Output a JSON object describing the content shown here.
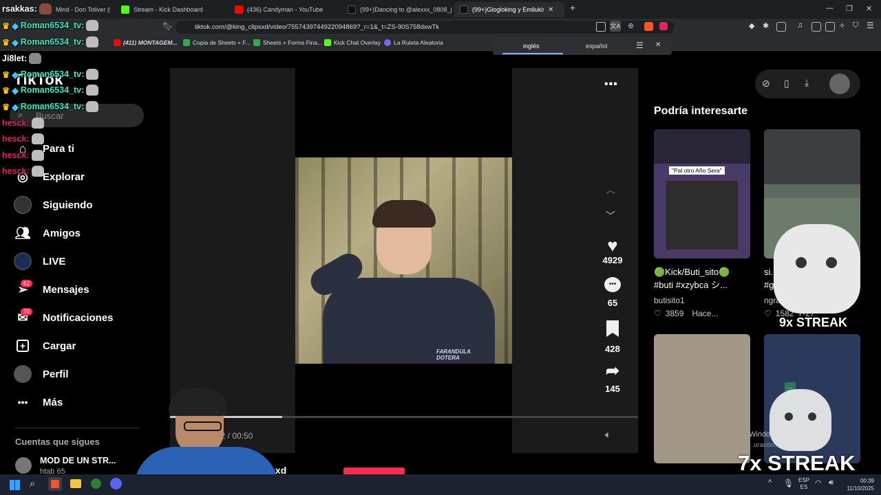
{
  "browser": {
    "tabs": [
      {
        "label": "Mind - Don Toliver (fe",
        "color": "#6b3a3a"
      },
      {
        "label": "Stream - Kick Dashboard",
        "color": "#53fc18"
      },
      {
        "label": "(436) Candyman - YouTube",
        "color": "#ff0000"
      },
      {
        "label": "(99+)Dancing to @alexxx_0808_j's Tr",
        "color": "#111111"
      },
      {
        "label": "(99+)Glogloking y Emilukis: I",
        "color": "#111111"
      }
    ],
    "new_tab": "+",
    "url": "tiktok.com/@king_clipsxd/video/7557439744922094869?_r=1&_t=ZS-90S758dxwTk",
    "bookmarks": [
      {
        "label": "(411) MONTAGEM...",
        "color": "#ff0000"
      },
      {
        "label": "Copia de Sheets + F...",
        "color": "#34a853"
      },
      {
        "label": "Sheets + Forms Fina...",
        "color": "#34a853"
      },
      {
        "label": "Kick Chat Overlay",
        "color": "#53fc18"
      },
      {
        "label": "La Ruleta Aleatoria",
        "color": "#7b68ee"
      }
    ],
    "translate": {
      "from": "inglés",
      "to": "español"
    }
  },
  "tiktok": {
    "logo": "TikTok",
    "search_placeholder": "Buscar",
    "nav": [
      {
        "label": "Para ti",
        "icon": "home-icon"
      },
      {
        "label": "Explorar",
        "icon": "compass-icon"
      },
      {
        "label": "Siguiendo",
        "icon": "following-icon"
      },
      {
        "label": "Amigos",
        "icon": "friends-icon"
      },
      {
        "label": "LIVE",
        "icon": "live-icon"
      },
      {
        "label": "Mensajes",
        "icon": "messages-icon",
        "badge": "62"
      },
      {
        "label": "Notificaciones",
        "icon": "notifications-icon",
        "badge": "70"
      },
      {
        "label": "Cargar",
        "icon": "upload-icon"
      },
      {
        "label": "Perfil",
        "icon": "profile-icon"
      },
      {
        "label": "Más",
        "icon": "more-icon"
      }
    ],
    "following_heading": "Cuentas que sigues",
    "following": [
      {
        "name": "MOD DE UN STR...",
        "handle": "htab 65"
      }
    ],
    "video": {
      "watermark": "FARANDULA\nDOTERA",
      "time": "12 / 00:50",
      "progress": 0.24,
      "author": "clipsxd"
    },
    "actions": {
      "likes": "4929",
      "comments": "65",
      "saves": "428",
      "shares": "145"
    },
    "recommend_heading": "Podría interesarte",
    "recommended": [
      {
        "caption": "🟢Kick/Buti_sito🟢 #buti #xzybca シ...",
        "author": "butisito1",
        "likes": "3859",
        "time": "Hace...",
        "banner": "\"Pal otro Año Sera\""
      },
      {
        "caption": "si... #g...",
        "author": "ngra...",
        "likes": "1582",
        "time": "7-27",
        "banner": ""
      }
    ]
  },
  "overlay": {
    "chat": [
      {
        "user": "rsakkas:",
        "color": "#ffffff"
      },
      {
        "user": "Roman6534_tv:",
        "color": "#3ee6c4"
      },
      {
        "user": "Roman6534_tv:",
        "color": "#3ee6c4"
      },
      {
        "user": "Ji8let:",
        "color": "#ffffff"
      },
      {
        "user": "Roman6534_tv:",
        "color": "#3ee6c4"
      },
      {
        "user": "Roman6534_tv:",
        "color": "#3ee6c4"
      },
      {
        "user": "Roman6534_tv:",
        "color": "#3ee6c4"
      },
      {
        "user": "hesck:",
        "color": "#e0245e"
      },
      {
        "user": "hesck:",
        "color": "#e0245e"
      },
      {
        "user": "hesck:",
        "color": "#e0245e"
      },
      {
        "user": "hesck:",
        "color": "#e0245e"
      }
    ],
    "streak1": "9x STREAK",
    "streak2": "7x STREAK",
    "notif_title": "Windo...",
    "notif_sub": "...uración..."
  },
  "taskbar": {
    "lang1": "ESP",
    "lang2": "ES",
    "time": "00:39",
    "date": "11/10/2025"
  }
}
